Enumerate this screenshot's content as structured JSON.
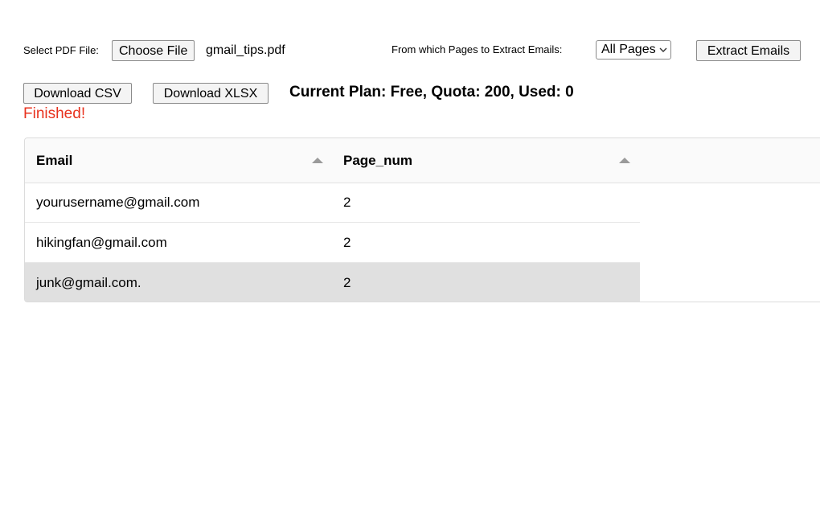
{
  "file_picker": {
    "label": "Select PDF File:",
    "button_label": "Choose File",
    "file_name": "gmail_tips.pdf"
  },
  "pages_select": {
    "label": "From which Pages to Extract Emails:",
    "selected": "All Pages"
  },
  "extract_button": "Extract Emails",
  "download": {
    "csv_label": "Download CSV",
    "xlsx_label": "Download XLSX"
  },
  "plan_info": "Current Plan: Free, Quota: 200, Used: 0",
  "status": "Finished!",
  "colors": {
    "status": "#e8321e",
    "selected_row": "#e0e0e0"
  },
  "table": {
    "columns": [
      "Email",
      "Page_num"
    ],
    "rows": [
      {
        "email": "yourusername@gmail.com",
        "page_num": "2"
      },
      {
        "email": "hikingfan@gmail.com",
        "page_num": "2"
      },
      {
        "email": "junk@gmail.com.",
        "page_num": "2"
      }
    ]
  }
}
